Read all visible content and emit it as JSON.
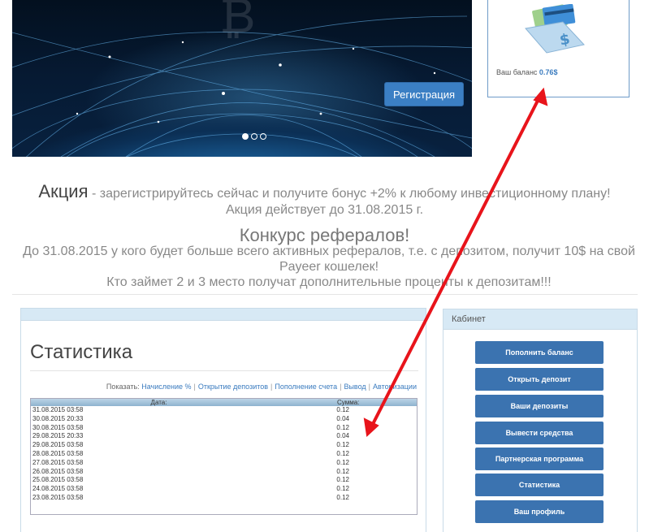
{
  "banner": {
    "register_label": "Регистрация",
    "slides": 3,
    "active_slide": 1
  },
  "balance": {
    "label": "Ваш баланс ",
    "value": "0.76$"
  },
  "promo": {
    "action_word": "Акция",
    "action_text": " - зарегистрируйтесь сейчас и получите бонус +2% к любому инвестиционному плану!",
    "action_deadline": "Акция действует до 31.08.2015 г.",
    "contest_title": "Конкурс рефералов!",
    "contest_line1": "До 31.08.2015 у кого будет больше всего активных рефералов, т.е. с депозитом, получит 10$ на свой Payeer кошелек!",
    "contest_line2": "Кто займет 2 и 3 место получат дополнительные проценты к депозитам!!!"
  },
  "stats": {
    "title": "Статистика",
    "show_label": "Показать:",
    "filters": [
      "Начисление %",
      "Открытие депозитов",
      "Пополнение счета",
      "Вывод",
      "Авторизации"
    ],
    "columns": [
      "Дата:",
      "Сумма:"
    ],
    "rows": [
      [
        "31.08.2015 03:58",
        "0.12"
      ],
      [
        "30.08.2015 20:33",
        "0.04"
      ],
      [
        "30.08.2015 03:58",
        "0.12"
      ],
      [
        "29.08.2015 20:33",
        "0.04"
      ],
      [
        "29.08.2015 03:58",
        "0.12"
      ],
      [
        "28.08.2015 03:58",
        "0.12"
      ],
      [
        "27.08.2015 03:58",
        "0.12"
      ],
      [
        "26.08.2015 03:58",
        "0.12"
      ],
      [
        "25.08.2015 03:58",
        "0.12"
      ],
      [
        "24.08.2015 03:58",
        "0.12"
      ],
      [
        "23.08.2015 03:58",
        "0.12"
      ]
    ]
  },
  "cabinet": {
    "title": "Кабинет",
    "items": [
      "Пополнить баланс",
      "Открыть депозит",
      "Ваши депозиты",
      "Вывести средства",
      "Партнерская программа",
      "Статистика",
      "Ваш профиль"
    ]
  },
  "colors": {
    "accent": "#3b73b0",
    "link": "#3a7bbf",
    "annotation_arrow": "#e8141b"
  }
}
